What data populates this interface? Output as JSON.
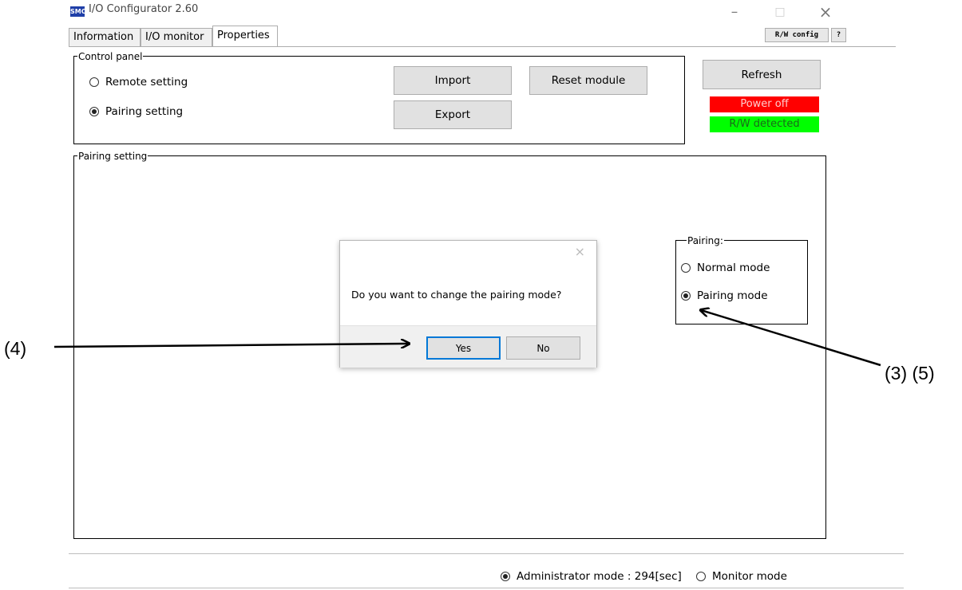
{
  "window": {
    "icon_text": "SMC",
    "title": "I/O Configurator 2.60",
    "minimize": "–",
    "maximize": "□",
    "close": "×"
  },
  "tabs": [
    {
      "label": "Information"
    },
    {
      "label": "I/O monitor"
    },
    {
      "label": "Properties"
    }
  ],
  "toolbar": {
    "rw_config_label": "R/W config",
    "help_label": "?"
  },
  "control_panel": {
    "label": "Control panel",
    "radios": [
      {
        "label": "Remote setting",
        "selected": false
      },
      {
        "label": "Pairing setting",
        "selected": true
      }
    ],
    "import_label": "Import",
    "export_label": "Export",
    "reset_label": "Reset module"
  },
  "side": {
    "refresh_label": "Refresh",
    "power_status": "Power off",
    "power_color": "#ff0000",
    "rw_status": "R/W detected",
    "rw_color": "#00ff00"
  },
  "pairing_setting": {
    "label": "Pairing setting",
    "pairing_box": {
      "label": "Pairing:",
      "options": [
        {
          "label": "Normal mode",
          "selected": false
        },
        {
          "label": "Pairing mode",
          "selected": true
        }
      ]
    }
  },
  "dialog": {
    "close": "×",
    "message": "Do you want to change the pairing mode?",
    "yes_label": "Yes",
    "no_label": "No"
  },
  "status_bar": {
    "admin_label": "Administrator mode : 294[sec]",
    "admin_selected": true,
    "monitor_label": "Monitor mode",
    "monitor_selected": false
  },
  "annotations": {
    "left": "(4)",
    "right": "(3) (5)"
  }
}
